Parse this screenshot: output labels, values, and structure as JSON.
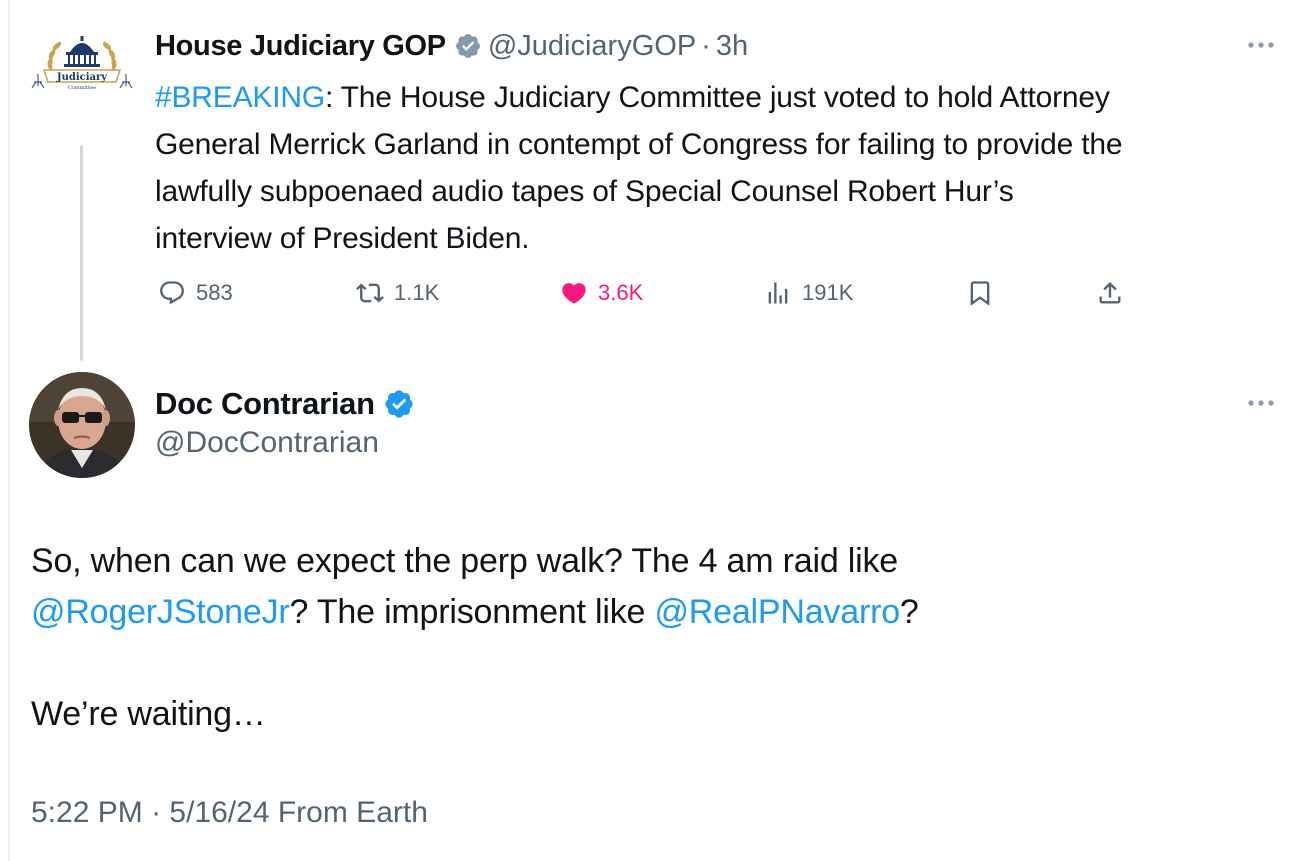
{
  "parent_tweet": {
    "author_name": "House Judiciary GOP",
    "handle": "@JudiciaryGOP",
    "separator": "·",
    "time": "3h",
    "avatar_logo_text": "Judiciary",
    "avatar_logo_subtext": "Committee",
    "text": {
      "hashtag": "#BREAKING",
      "line1_rest": ": The House Judiciary Committee just voted to hold Attorney",
      "line2": "General Merrick Garland in contempt of Congress for failing to provide the",
      "line3": "lawfully subpoenaed audio tapes of Special Counsel Robert Hur’s",
      "line4": "interview of President Biden."
    },
    "stats": {
      "replies": "583",
      "reposts": "1.1K",
      "likes": "3.6K",
      "views": "191K"
    },
    "icons": {
      "verified": "gray-verified-badge-icon",
      "more": "more-dots-icon",
      "reply": "reply-bubble-icon",
      "repost": "repost-icon",
      "like": "heart-filled-icon",
      "views": "views-bars-icon",
      "bookmark": "bookmark-icon",
      "share": "share-upload-icon"
    }
  },
  "reply_tweet": {
    "author_name": "Doc Contrarian",
    "handle": "@DocContrarian",
    "body": {
      "line1": "So, when can we expect the perp walk? The 4 am raid like",
      "mention1": "@RogerJStoneJr",
      "mid": "? The imprisonment like ",
      "mention2": "@RealPNavarro",
      "end": "?",
      "line3": "We’re waiting…"
    },
    "meta": {
      "time": "5:22 PM",
      "separator": "·",
      "date": "5/16/24",
      "source": "From Earth"
    },
    "icons": {
      "verified": "blue-verified-badge-icon",
      "more": "more-dots-icon"
    }
  },
  "colors": {
    "text": "#0f1419",
    "secondary": "#536471",
    "link": "#1d9bf0",
    "like": "#f91880",
    "verified_blue": "#1d9bf0",
    "verified_gray": "#829aab",
    "thread_line": "#cfd9de"
  }
}
